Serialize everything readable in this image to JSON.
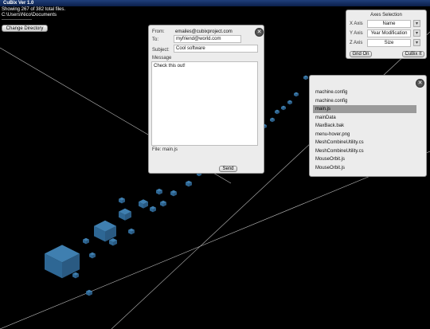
{
  "window": {
    "title": "CuBix Ver 1.0"
  },
  "status": {
    "showing": "Showing 267 of 382 total files.",
    "path": "C:\\Users\\Nico\\Documents"
  },
  "toolbar": {
    "change_directory": "Change Directory"
  },
  "email": {
    "from_label": "From:",
    "from_value": "emailes@cubixproject.com",
    "to_label": "To:",
    "to_value": "myfriend@world.com",
    "subject_label": "Subject:",
    "subject_value": "Cool software",
    "message_label": "Message",
    "message_value": "Check this out!",
    "file_label": "File: main.js",
    "send_label": "Send"
  },
  "axes": {
    "title": "Axes Selection",
    "x_label": "X Axis",
    "x_value": "Name",
    "y_label": "Y Axis",
    "y_value": "Year Modification",
    "z_label": "Z Axis",
    "z_value": "Size",
    "grid_label": "Grid On",
    "cubix_label": "CuBix It"
  },
  "files": {
    "items": [
      "machine.config",
      "machine.config",
      "main.js",
      "mainData",
      "MaxBack.bak",
      "menu-hover.png",
      "MeshCombineUtility.cs",
      "MeshCombineUtility.cs",
      "MouseOrbit.js",
      "MouseOrbit.js"
    ],
    "selected_index": 2
  },
  "colors": {
    "cube": "#3f7fb0",
    "panel": "#ececec",
    "selected": "#9a9a9a"
  }
}
